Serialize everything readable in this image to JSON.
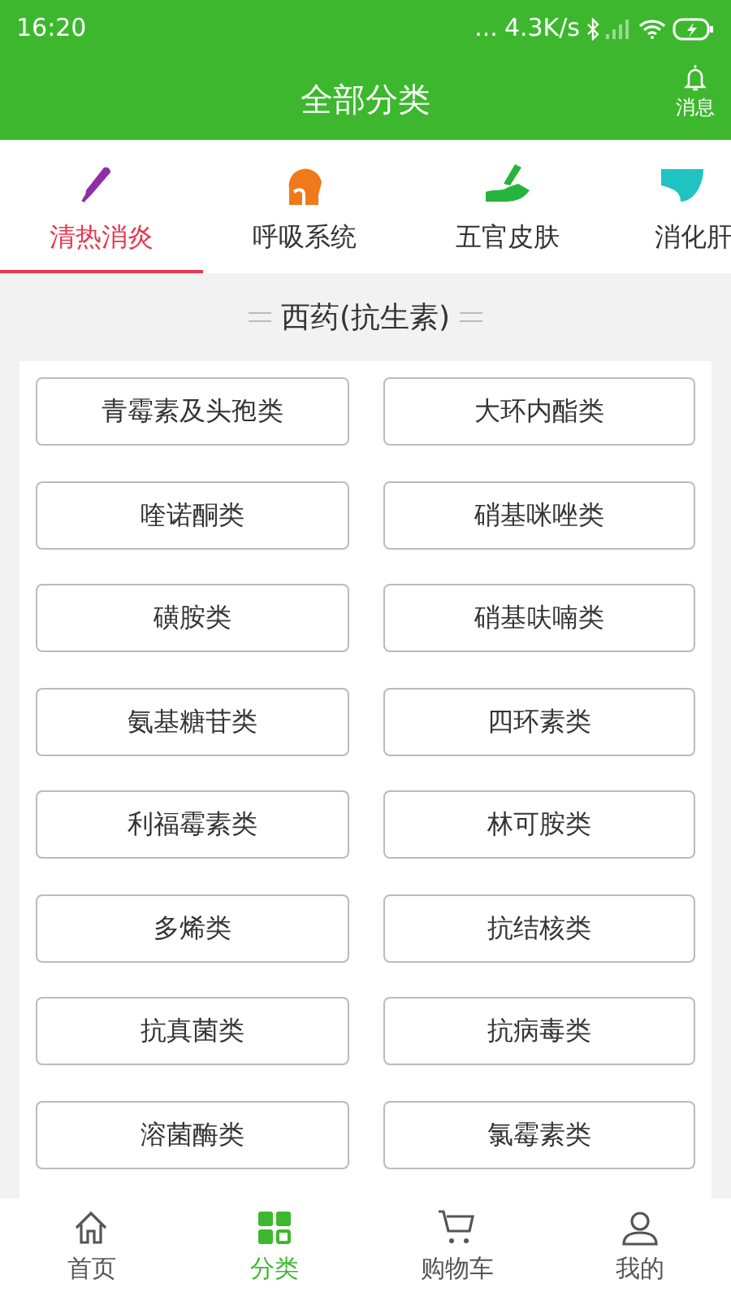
{
  "status_bar": {
    "time": "16:20",
    "dots": "...",
    "speed": "4.3K/s"
  },
  "header": {
    "title": "全部分类",
    "message_label": "消息"
  },
  "tabs": [
    {
      "label": "清热消炎",
      "selected": true,
      "color": "#8e2fa8"
    },
    {
      "label": "呼吸系统",
      "selected": false,
      "color": "#f07a1a"
    },
    {
      "label": "五官皮肤",
      "selected": false,
      "color": "#27b43c"
    },
    {
      "label": "消化肝",
      "selected": false,
      "color": "#1fc3c3"
    }
  ],
  "section_title": "西药(抗生素)",
  "categories": [
    "青霉素及头孢类",
    "大环内酯类",
    "喹诺酮类",
    "硝基咪唑类",
    "磺胺类",
    "硝基呋喃类",
    "氨基糖苷类",
    "四环素类",
    "利福霉素类",
    "林可胺类",
    "多烯类",
    "抗结核类",
    "抗真菌类",
    "抗病毒类",
    "溶菌酶类",
    "氯霉素类"
  ],
  "bottom_nav": [
    {
      "label": "首页",
      "selected": false,
      "kind": "home"
    },
    {
      "label": "分类",
      "selected": true,
      "kind": "grid"
    },
    {
      "label": "购物车",
      "selected": false,
      "kind": "cart"
    },
    {
      "label": "我的",
      "selected": false,
      "kind": "person"
    }
  ]
}
